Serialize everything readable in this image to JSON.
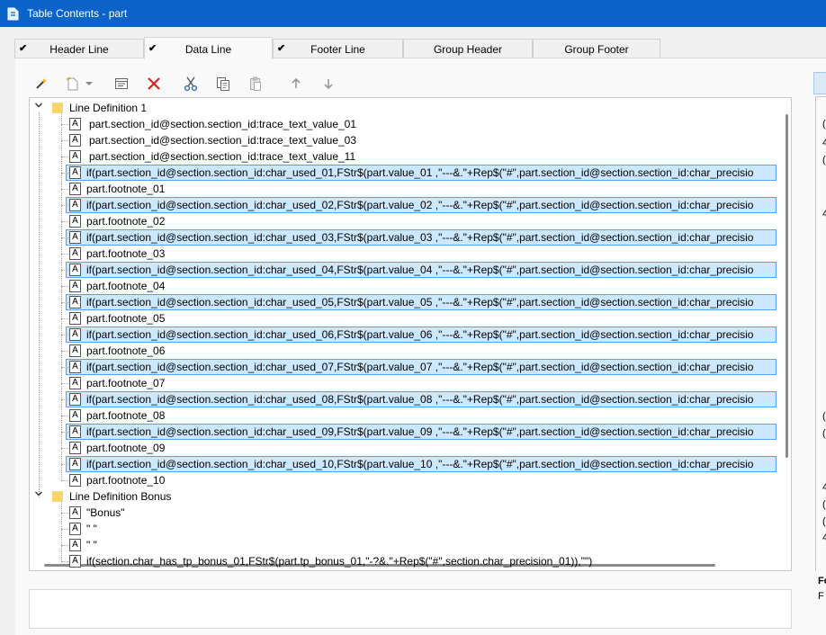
{
  "window": {
    "title": "Table Contents - part"
  },
  "tabs": [
    {
      "label": "Header Line",
      "checked": true,
      "active": false
    },
    {
      "label": "Data Line",
      "checked": true,
      "active": true
    },
    {
      "label": "Footer Line",
      "checked": true,
      "active": false
    },
    {
      "label": "Group Header",
      "checked": false,
      "active": false
    },
    {
      "label": "Group Footer",
      "checked": false,
      "active": false
    }
  ],
  "toolbar": {
    "icons": [
      "wand-icon",
      "new-item-icon",
      "dropdown-arrow-icon",
      "properties-icon",
      "delete-icon",
      "cut-icon",
      "copy-icon",
      "paste-icon",
      "move-up-icon",
      "move-down-icon"
    ],
    "delete_color": "#e02020"
  },
  "tree": {
    "groups": [
      {
        "label": "Line Definition  1",
        "items": [
          {
            "text": "part.section_id@section.section_id:trace_text_value_01",
            "selected": false
          },
          {
            "text": "part.section_id@section.section_id:trace_text_value_03",
            "selected": false
          },
          {
            "text": "part.section_id@section.section_id:trace_text_value_11",
            "selected": false
          },
          {
            "text": "if(part.section_id@section.section_id:char_used_01,FStr$(part.value_01 ,\"---&.\"+Rep$(\"#\",part.section_id@section.section_id:char_precisio",
            "selected": true
          },
          {
            "text": "part.footnote_01",
            "selected": false
          },
          {
            "text": "if(part.section_id@section.section_id:char_used_02,FStr$(part.value_02 ,\"---&.\"+Rep$(\"#\",part.section_id@section.section_id:char_precisio",
            "selected": true
          },
          {
            "text": "part.footnote_02",
            "selected": false
          },
          {
            "text": "if(part.section_id@section.section_id:char_used_03,FStr$(part.value_03 ,\"---&.\"+Rep$(\"#\",part.section_id@section.section_id:char_precisio",
            "selected": true
          },
          {
            "text": "part.footnote_03",
            "selected": false
          },
          {
            "text": "if(part.section_id@section.section_id:char_used_04,FStr$(part.value_04 ,\"---&.\"+Rep$(\"#\",part.section_id@section.section_id:char_precisio",
            "selected": true
          },
          {
            "text": "part.footnote_04",
            "selected": false
          },
          {
            "text": "if(part.section_id@section.section_id:char_used_05,FStr$(part.value_05 ,\"---&.\"+Rep$(\"#\",part.section_id@section.section_id:char_precisio",
            "selected": true
          },
          {
            "text": "part.footnote_05",
            "selected": false
          },
          {
            "text": "if(part.section_id@section.section_id:char_used_06,FStr$(part.value_06 ,\"---&.\"+Rep$(\"#\",part.section_id@section.section_id:char_precisio",
            "selected": true
          },
          {
            "text": "part.footnote_06",
            "selected": false
          },
          {
            "text": "if(part.section_id@section.section_id:char_used_07,FStr$(part.value_07 ,\"---&.\"+Rep$(\"#\",part.section_id@section.section_id:char_precisio",
            "selected": true
          },
          {
            "text": "part.footnote_07",
            "selected": false
          },
          {
            "text": "if(part.section_id@section.section_id:char_used_08,FStr$(part.value_08 ,\"---&.\"+Rep$(\"#\",part.section_id@section.section_id:char_precisio",
            "selected": true
          },
          {
            "text": "part.footnote_08",
            "selected": false
          },
          {
            "text": "if(part.section_id@section.section_id:char_used_09,FStr$(part.value_09 ,\"---&.\"+Rep$(\"#\",part.section_id@section.section_id:char_precisio",
            "selected": true
          },
          {
            "text": "part.footnote_09",
            "selected": false
          },
          {
            "text": "if(part.section_id@section.section_id:char_used_10,FStr$(part.value_10 ,\"---&.\"+Rep$(\"#\",part.section_id@section.section_id:char_precisio",
            "selected": true
          },
          {
            "text": "part.footnote_10",
            "selected": false
          }
        ]
      },
      {
        "label": "Line Definition Bonus",
        "items": [
          {
            "text": "\"Bonus\"",
            "selected": false
          },
          {
            "text": "\" \"",
            "selected": false
          },
          {
            "text": "\" \"",
            "selected": false
          },
          {
            "text": "if(section.char_has_tp_bonus_01,FStr$(part.tp_bonus_01,\"-?&.\"+Rep$(\"#\",section.char_precision_01)),\"\")",
            "selected": false
          }
        ]
      }
    ]
  },
  "item_type_icon_text": "A",
  "right_panel_text": [
    "(",
    "4",
    "(",
    "4",
    "(",
    "(",
    "4",
    "(",
    "(",
    "4",
    "Fe",
    "F"
  ],
  "colors": {
    "titlebar": "#0a64c8",
    "selection_fill": "#cce8ff",
    "selection_border": "#4da3ff"
  }
}
